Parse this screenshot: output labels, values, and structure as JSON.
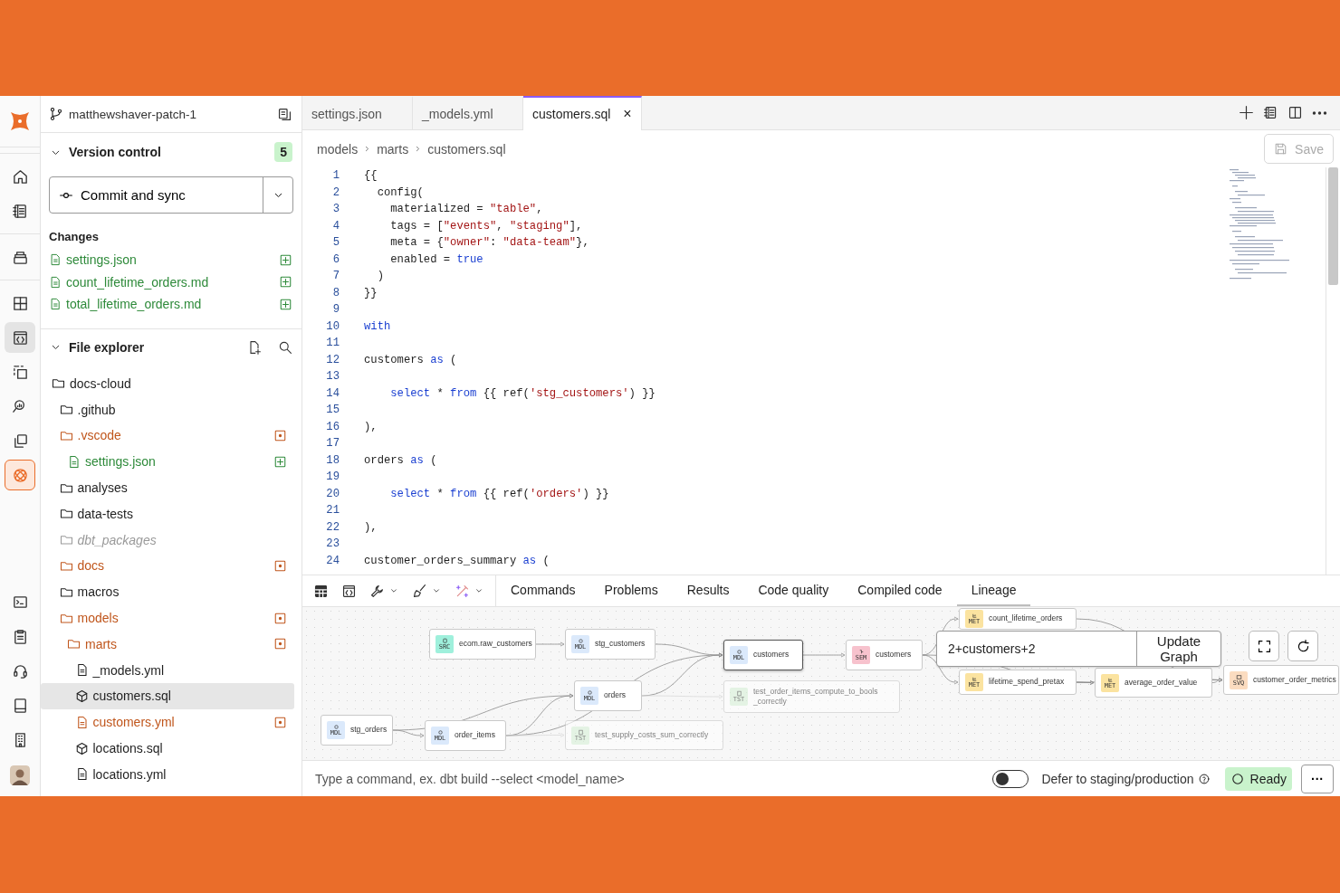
{
  "rail_items": [
    {
      "kind": "home",
      "selected": false
    },
    {
      "kind": "notebook",
      "selected": false
    },
    {
      "kind": "stack",
      "selected": false
    },
    {
      "kind": "grid",
      "selected": false
    },
    {
      "kind": "code",
      "selected": true
    },
    {
      "kind": "dashed",
      "selected": false
    },
    {
      "kind": "inspect",
      "selected": false
    },
    {
      "kind": "copy",
      "selected": false
    },
    {
      "kind": "assistant",
      "selected": false
    }
  ],
  "rail_bottom": [
    {
      "kind": "terminal"
    },
    {
      "kind": "clipboard"
    },
    {
      "kind": "headset"
    },
    {
      "kind": "book"
    },
    {
      "kind": "building"
    }
  ],
  "sidebar": {
    "branch": "matthewshaver-patch-1",
    "version_control": {
      "title": "Version control",
      "expanded": true,
      "count": "5",
      "commit_button": "Commit and sync",
      "changes_label": "Changes",
      "changes": [
        {
          "name": "settings.json",
          "added": true
        },
        {
          "name": "count_lifetime_orders.md",
          "added": true
        },
        {
          "name": "total_lifetime_orders.md",
          "added": true
        }
      ]
    },
    "file_explorer": {
      "title": "File explorer",
      "expanded": true,
      "tree": [
        {
          "name": "docs-cloud",
          "kind": "folder",
          "added": false,
          "modified": false,
          "ignored": false,
          "selected": false,
          "children": [
            {
              "name": ".github",
              "kind": "folder",
              "added": false,
              "modified": false,
              "ignored": false,
              "selected": false
            },
            {
              "name": ".vscode",
              "kind": "folder",
              "added": false,
              "modified": true,
              "ignored": false,
              "selected": false,
              "children": [
                {
                  "name": "settings.json",
                  "kind": "file",
                  "added": true,
                  "modified": false,
                  "ignored": false,
                  "selected": false
                }
              ]
            },
            {
              "name": "analyses",
              "kind": "folder",
              "added": false,
              "modified": false,
              "ignored": false,
              "selected": false
            },
            {
              "name": "data-tests",
              "kind": "folder",
              "added": false,
              "modified": false,
              "ignored": false,
              "selected": false
            },
            {
              "name": "dbt_packages",
              "kind": "folder",
              "added": false,
              "modified": false,
              "ignored": true,
              "selected": false
            },
            {
              "name": "docs",
              "kind": "folder",
              "added": false,
              "modified": true,
              "ignored": false,
              "selected": false
            },
            {
              "name": "macros",
              "kind": "folder",
              "added": false,
              "modified": false,
              "ignored": false,
              "selected": false
            },
            {
              "name": "models",
              "kind": "folder",
              "added": false,
              "modified": true,
              "ignored": false,
              "selected": false,
              "children": [
                {
                  "name": "marts",
                  "kind": "folder",
                  "added": false,
                  "modified": true,
                  "ignored": false,
                  "selected": false,
                  "children": [
                    {
                      "name": "_models.yml",
                      "kind": "file",
                      "added": false,
                      "modified": false,
                      "ignored": false,
                      "selected": false
                    },
                    {
                      "name": "customers.sql",
                      "kind": "model",
                      "added": false,
                      "modified": false,
                      "ignored": false,
                      "selected": true
                    },
                    {
                      "name": "customers.yml",
                      "kind": "file",
                      "added": false,
                      "modified": true,
                      "ignored": false,
                      "selected": false
                    },
                    {
                      "name": "locations.sql",
                      "kind": "model",
                      "added": false,
                      "modified": false,
                      "ignored": false,
                      "selected": false
                    },
                    {
                      "name": "locations.yml",
                      "kind": "file",
                      "added": false,
                      "modified": false,
                      "ignored": false,
                      "selected": false
                    }
                  ]
                }
              ]
            }
          ]
        }
      ]
    }
  },
  "tabs": [
    {
      "label": "settings.json",
      "selected": false
    },
    {
      "label": "_models.yml",
      "selected": false
    },
    {
      "label": "customers.sql",
      "selected": true,
      "close": "×"
    }
  ],
  "breadcrumb": [
    "models",
    "marts",
    "customers.sql"
  ],
  "save_button": {
    "label": "Save",
    "disabled": true
  },
  "code_lines": [
    {
      "n": "1",
      "segments": [
        {
          "text": "{{"
        }
      ]
    },
    {
      "n": "2",
      "segments": [
        {
          "text": "  config("
        }
      ]
    },
    {
      "n": "3",
      "segments": [
        {
          "text": "    materialized = "
        },
        {
          "text": "\"table\"",
          "kind": "string"
        },
        {
          "text": ","
        }
      ]
    },
    {
      "n": "4",
      "segments": [
        {
          "text": "    tags = ["
        },
        {
          "text": "\"events\"",
          "kind": "string"
        },
        {
          "text": ", "
        },
        {
          "text": "\"staging\"",
          "kind": "string"
        },
        {
          "text": "],"
        }
      ]
    },
    {
      "n": "5",
      "segments": [
        {
          "text": "    meta = {"
        },
        {
          "text": "\"owner\"",
          "kind": "string"
        },
        {
          "text": ": "
        },
        {
          "text": "\"data-team\"",
          "kind": "string"
        },
        {
          "text": "},"
        }
      ]
    },
    {
      "n": "6",
      "segments": [
        {
          "text": "    enabled = "
        },
        {
          "text": "true",
          "kind": "keyword"
        }
      ]
    },
    {
      "n": "7",
      "segments": [
        {
          "text": "  )"
        }
      ]
    },
    {
      "n": "8",
      "segments": [
        {
          "text": "}}"
        }
      ]
    },
    {
      "n": "9"
    },
    {
      "n": "10",
      "segments": [
        {
          "text": "with",
          "kind": "keyword"
        }
      ]
    },
    {
      "n": "11"
    },
    {
      "n": "12",
      "segments": [
        {
          "text": "customers "
        },
        {
          "text": "as",
          "kind": "keyword"
        },
        {
          "text": " ("
        }
      ]
    },
    {
      "n": "13"
    },
    {
      "n": "14",
      "segments": [
        {
          "text": "    select",
          "kind": "keyword"
        },
        {
          "text": " * "
        },
        {
          "text": "from",
          "kind": "keyword"
        },
        {
          "text": " {{ ref("
        },
        {
          "text": "'stg_customers'",
          "kind": "string"
        },
        {
          "text": ") }}"
        }
      ]
    },
    {
      "n": "15"
    },
    {
      "n": "16",
      "segments": [
        {
          "text": "),"
        }
      ]
    },
    {
      "n": "17"
    },
    {
      "n": "18",
      "segments": [
        {
          "text": "orders "
        },
        {
          "text": "as",
          "kind": "keyword"
        },
        {
          "text": " ("
        }
      ]
    },
    {
      "n": "19"
    },
    {
      "n": "20",
      "segments": [
        {
          "text": "    select",
          "kind": "keyword"
        },
        {
          "text": " * "
        },
        {
          "text": "from",
          "kind": "keyword"
        },
        {
          "text": " {{ ref("
        },
        {
          "text": "'orders'",
          "kind": "string"
        },
        {
          "text": ") }}"
        }
      ]
    },
    {
      "n": "21"
    },
    {
      "n": "22",
      "segments": [
        {
          "text": "),"
        }
      ]
    },
    {
      "n": "23"
    },
    {
      "n": "24",
      "segments": [
        {
          "text": "customer_orders_summary "
        },
        {
          "text": "as",
          "kind": "keyword"
        },
        {
          "text": " ("
        }
      ]
    }
  ],
  "panel": {
    "tools": [
      {
        "kind": "table",
        "dropdown": false
      },
      {
        "kind": "code",
        "dropdown": false
      },
      {
        "kind": "wrench",
        "dropdown": true
      },
      {
        "kind": "broom",
        "dropdown": true
      },
      {
        "kind": "magic",
        "dropdown": true
      }
    ],
    "tabs": [
      {
        "label": "Commands",
        "selected": false
      },
      {
        "label": "Problems",
        "selected": false
      },
      {
        "label": "Results",
        "selected": false
      },
      {
        "label": "Code quality",
        "selected": false
      },
      {
        "label": "Compiled code",
        "selected": false
      },
      {
        "label": "Lineage",
        "selected": true
      }
    ]
  },
  "lineage": {
    "selector": "2+customers+2",
    "update_button": "Update Graph",
    "nodes": [
      {
        "label": "ecom.raw_customers",
        "kind": "source",
        "badge": "SRC",
        "dimmed": false,
        "selected": false
      },
      {
        "label": "stg_customers",
        "kind": "model",
        "badge": "MDL",
        "dimmed": false,
        "selected": false
      },
      {
        "label": "customers",
        "kind": "model",
        "badge": "MDL",
        "dimmed": false,
        "selected": true
      },
      {
        "label": "orders",
        "kind": "model",
        "badge": "MDL",
        "dimmed": false,
        "selected": false
      },
      {
        "label": "test_order_items_compute_to_bools _correctly",
        "kind": "test",
        "badge": "TST",
        "dimmed": true,
        "selected": false
      },
      {
        "label": "stg_orders",
        "kind": "model",
        "badge": "MDL",
        "dimmed": false,
        "selected": false
      },
      {
        "label": "order_items",
        "kind": "model",
        "badge": "MDL",
        "dimmed": false,
        "selected": false
      },
      {
        "label": "test_supply_costs_sum_correctly",
        "kind": "test",
        "badge": "TST",
        "dimmed": true,
        "selected": false
      },
      {
        "label": "customers",
        "kind": "semantic",
        "badge": "SEM",
        "dimmed": false,
        "selected": false
      },
      {
        "label": "count_lifetime_orders",
        "kind": "metric",
        "badge": "MET",
        "dimmed": false,
        "selected": false
      },
      {
        "label": "lifetime_spend_pretax",
        "kind": "metric",
        "badge": "MET",
        "dimmed": false,
        "selected": false
      },
      {
        "label": "average_order_value",
        "kind": "metric",
        "badge": "MET",
        "dimmed": false,
        "selected": false
      },
      {
        "label": "customer_order_metrics",
        "kind": "saved_query",
        "badge": "SVQ",
        "dimmed": false,
        "selected": false
      }
    ]
  },
  "command_bar": {
    "placeholder": "Type a command, ex. dbt build --select <model_name>",
    "defer_toggle": {
      "label": "Defer to staging/production",
      "on": false
    },
    "status": "Ready",
    "more": "···"
  }
}
